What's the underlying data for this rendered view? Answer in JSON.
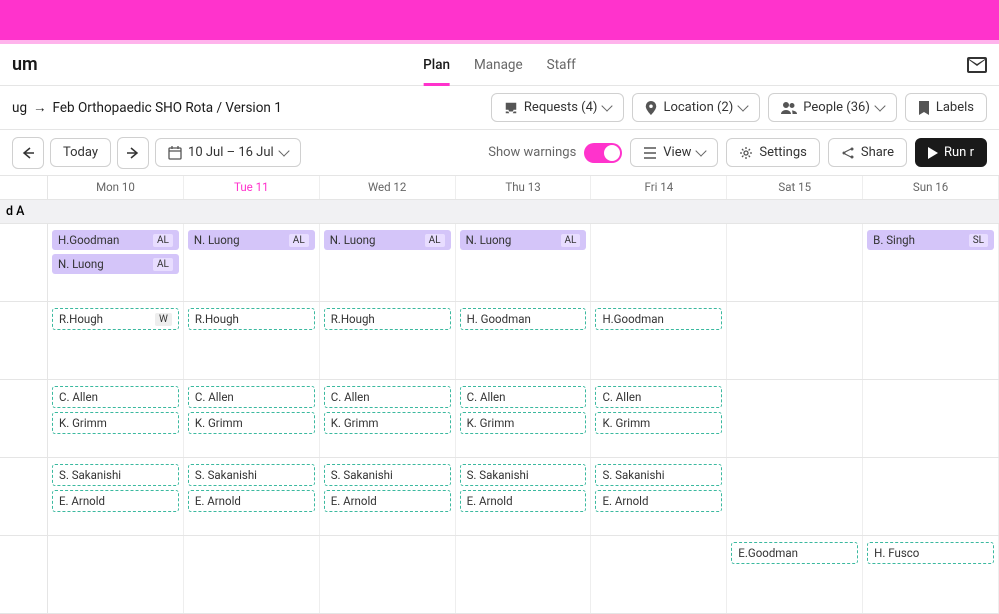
{
  "logo": "um",
  "tabs": {
    "plan": "Plan",
    "manage": "Manage",
    "staff": "Staff"
  },
  "breadcrumb": {
    "part1": "ug",
    "part2": "Feb Orthopaedic SHO Rota / Version 1"
  },
  "filters": {
    "requests": "Requests (4)",
    "location": "Location (2)",
    "people": "People (36)",
    "labels": "Labels"
  },
  "toolbar": {
    "today": "Today",
    "daterange": "10 Jul – 16 Jul",
    "warnings": "Show warnings",
    "view": "View",
    "settings": "Settings",
    "share": "Share",
    "run": "Run r"
  },
  "days": [
    {
      "label": "Mon 10"
    },
    {
      "label": "Tue 11",
      "hl": true
    },
    {
      "label": "Wed 12"
    },
    {
      "label": "Thu 13"
    },
    {
      "label": "Fri 14"
    },
    {
      "label": "Sat 15"
    },
    {
      "label": "Sun 16"
    }
  ],
  "section": "d A",
  "rows": [
    [
      [
        {
          "n": "H.Goodman",
          "b": "AL",
          "s": true
        },
        {
          "n": "N. Luong",
          "b": "AL",
          "s": true
        }
      ],
      [
        {
          "n": "N. Luong",
          "b": "AL",
          "s": true
        }
      ],
      [
        {
          "n": "N. Luong",
          "b": "AL",
          "s": true
        }
      ],
      [
        {
          "n": "N. Luong",
          "b": "AL",
          "s": true
        }
      ],
      [],
      [],
      [
        {
          "n": "B. Singh",
          "b": "SL",
          "s": true
        }
      ]
    ],
    [
      [
        {
          "n": "R.Hough",
          "b": "W"
        }
      ],
      [
        {
          "n": "R.Hough"
        }
      ],
      [
        {
          "n": "R.Hough"
        }
      ],
      [
        {
          "n": "H. Goodman"
        }
      ],
      [
        {
          "n": "H.Goodman"
        }
      ],
      [],
      []
    ],
    [
      [
        {
          "n": "C. Allen"
        },
        {
          "n": "K. Grimm"
        }
      ],
      [
        {
          "n": "C. Allen"
        },
        {
          "n": "K. Grimm"
        }
      ],
      [
        {
          "n": "C. Allen"
        },
        {
          "n": "K. Grimm"
        }
      ],
      [
        {
          "n": "C. Allen"
        },
        {
          "n": "K. Grimm"
        }
      ],
      [
        {
          "n": "C. Allen"
        },
        {
          "n": "K. Grimm"
        }
      ],
      [],
      []
    ],
    [
      [
        {
          "n": "S. Sakanishi"
        },
        {
          "n": "E. Arnold"
        }
      ],
      [
        {
          "n": "S. Sakanishi"
        },
        {
          "n": "E. Arnold"
        }
      ],
      [
        {
          "n": "S. Sakanishi"
        },
        {
          "n": "E. Arnold"
        }
      ],
      [
        {
          "n": "S. Sakanishi"
        },
        {
          "n": "E. Arnold"
        }
      ],
      [
        {
          "n": "S. Sakanishi"
        },
        {
          "n": "E. Arnold"
        }
      ],
      [],
      []
    ],
    [
      [],
      [],
      [],
      [],
      [],
      [
        {
          "n": "E.Goodman"
        }
      ],
      [
        {
          "n": "H. Fusco"
        }
      ]
    ]
  ]
}
